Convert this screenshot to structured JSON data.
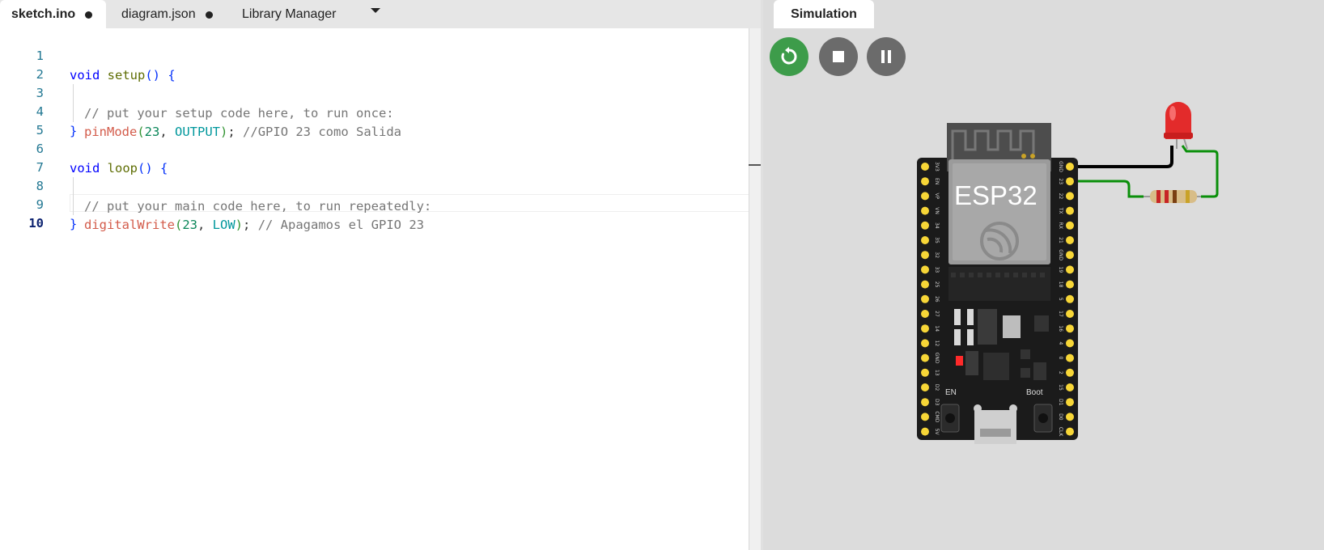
{
  "editor": {
    "tabs": [
      {
        "label": "sketch.ino",
        "unsaved": true,
        "active": true
      },
      {
        "label": "diagram.json",
        "unsaved": true,
        "active": false
      },
      {
        "label": "Library Manager",
        "unsaved": false,
        "active": false
      }
    ],
    "line_numbers": [
      "1",
      "2",
      "3",
      "4",
      "5",
      "6",
      "7",
      "8",
      "9",
      "10"
    ],
    "current_line": "10",
    "code": {
      "l1": {
        "kw": "void",
        "fn": "setup",
        "paren": "()",
        "brace": "{"
      },
      "l2": {
        "comment": "// put your setup code here, to run once:"
      },
      "l3": {
        "fn": "pinMode",
        "open": "(",
        "num": "23",
        "sep": ", ",
        "const": "OUTPUT",
        "close": ")",
        "semi": "; ",
        "comment": "//GPIO 23 como Salida"
      },
      "l4": {
        "brace": "}"
      },
      "l6": {
        "kw": "void",
        "fn": "loop",
        "paren": "()",
        "brace": "{"
      },
      "l7": {
        "comment": "// put your main code here, to run repeatedly:"
      },
      "l8": {
        "fn": "digitalWrite",
        "open": "(",
        "num": "23",
        "sep": ", ",
        "const": "LOW",
        "close": ")",
        "semi": "; ",
        "comment": "// Apagamos el GPIO 23"
      },
      "l9": {
        "brace": "}"
      }
    }
  },
  "simulation": {
    "tab_label": "Simulation",
    "controls": {
      "restart_icon": "restart-icon",
      "stop_icon": "stop-icon",
      "pause_icon": "pause-icon"
    },
    "board": {
      "label": "ESP32",
      "en_label": "EN",
      "boot_label": "Boot",
      "left_pins": [
        "3V3",
        "EN",
        "VP",
        "VN",
        "34",
        "35",
        "32",
        "33",
        "25",
        "26",
        "27",
        "14",
        "12",
        "GND",
        "13",
        "D2",
        "D3",
        "CMD",
        "5V"
      ],
      "right_pins": [
        "GND",
        "23",
        "22",
        "TX",
        "RX",
        "21",
        "GND",
        "19",
        "18",
        "5",
        "17",
        "16",
        "4",
        "0",
        "2",
        "15",
        "D1",
        "D0",
        "CLK"
      ]
    },
    "colors": {
      "led": "#ff2a2a",
      "wire_black": "#000000",
      "wire_green": "#0a8f0a",
      "board": "#1b1b1b",
      "pin": "#f7d637"
    }
  }
}
